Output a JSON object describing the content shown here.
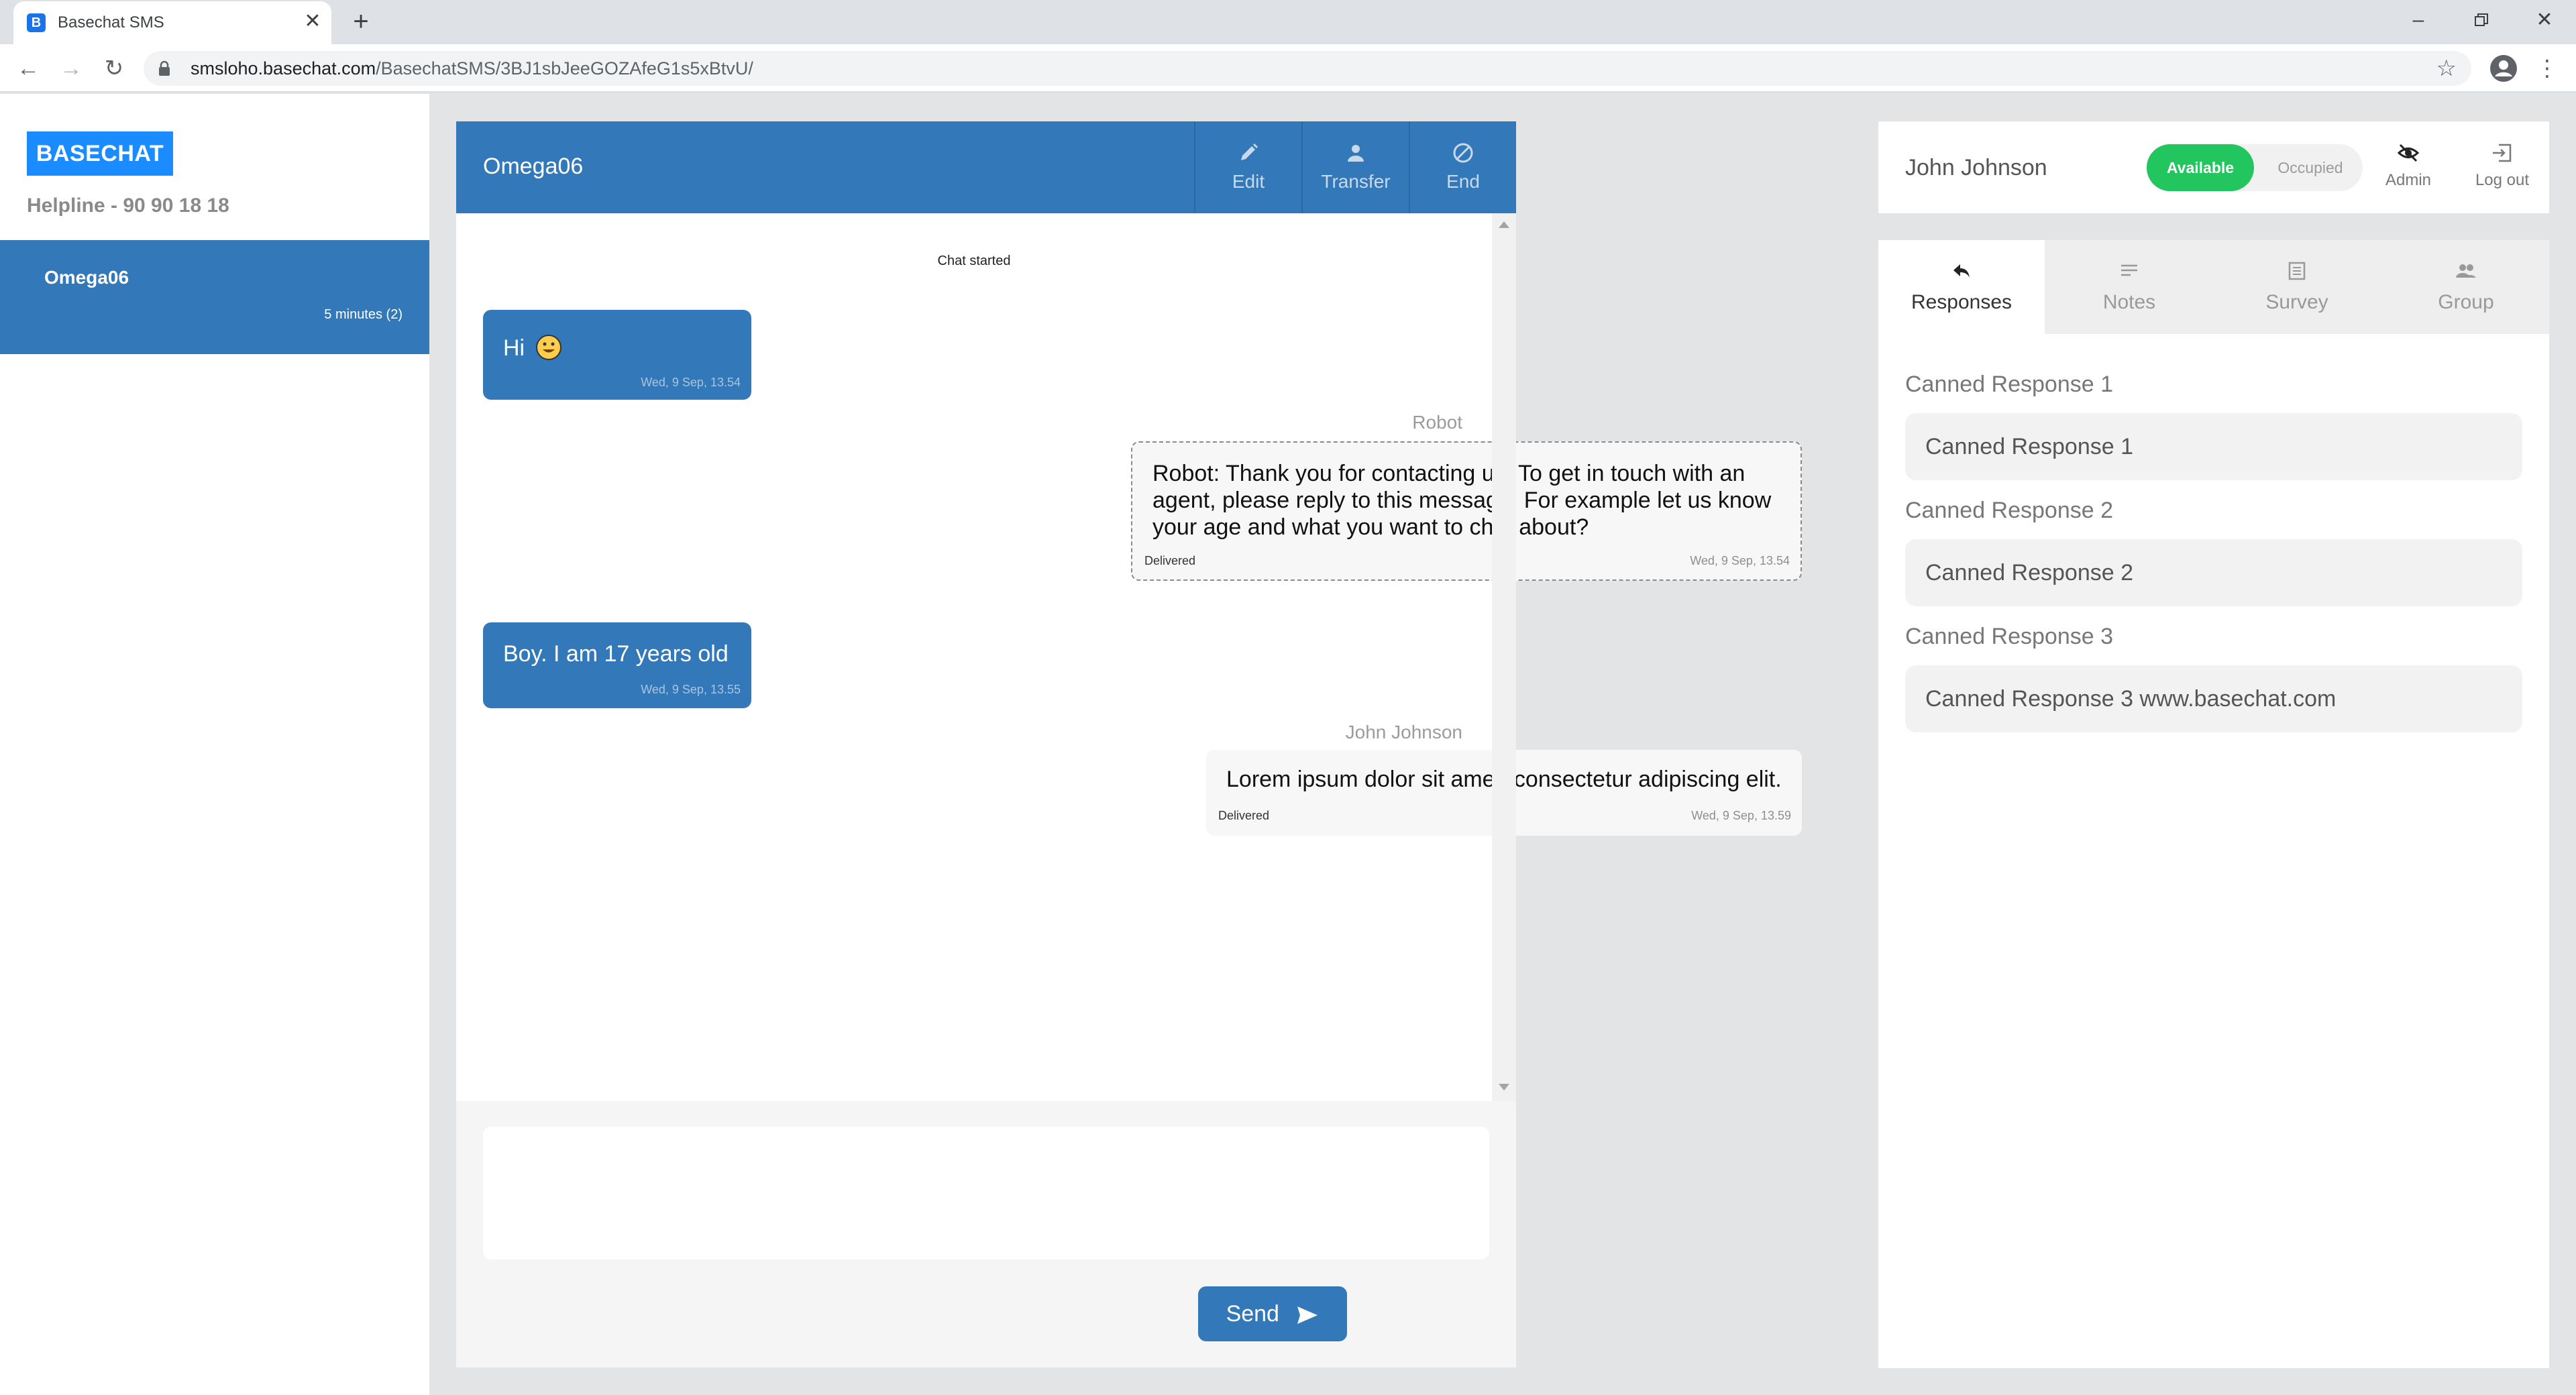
{
  "browser": {
    "tab_title": "Basechat SMS",
    "favicon_letter": "B",
    "url_host": "smsloho.basechat.com",
    "url_path": "/BasechatSMS/3BJ1sbJeeGOZAfeG1s5xBtvU/"
  },
  "sidebar": {
    "logo": "BASECHAT",
    "helpline": "Helpline - 90 90 18 18",
    "conversations": [
      {
        "name": "Omega06",
        "meta": "5 minutes (2)"
      }
    ]
  },
  "chat": {
    "title": "Omega06",
    "actions": {
      "edit": "Edit",
      "transfer": "Transfer",
      "end": "End"
    },
    "chat_started": "Chat started",
    "messages": [
      {
        "text": "Hi",
        "time": "Wed, 9 Sep, 13.54"
      },
      {
        "sender": "Robot",
        "text": "Robot: Thank you for contacting us. To get in touch with an agent, please reply to this message. For example let us know your age and what you want to chat about?",
        "status": "Delivered",
        "time": "Wed, 9 Sep, 13.54"
      },
      {
        "text": "Boy. I am 17 years old",
        "time": "Wed, 9 Sep, 13.55"
      },
      {
        "sender": "John Johnson",
        "text": "Lorem ipsum dolor sit amet, consectetur adipiscing elit.",
        "status": "Delivered",
        "time": "Wed, 9 Sep, 13.59"
      }
    ],
    "input_value": "",
    "send_label": "Send"
  },
  "agent": {
    "name": "John Johnson",
    "status_available": "Available",
    "status_occupied": "Occupied",
    "admin_label": "Admin",
    "logout_label": "Log out"
  },
  "side_panel": {
    "tabs": [
      "Responses",
      "Notes",
      "Survey",
      "Group"
    ],
    "active_tab": "Responses",
    "canned": [
      {
        "title": "Canned Response 1",
        "text": "Canned Response 1"
      },
      {
        "title": "Canned Response 2",
        "text": "Canned Response 2"
      },
      {
        "title": "Canned Response 3",
        "text": "Canned Response 3 www.basechat.com"
      }
    ]
  },
  "colors": {
    "brand_blue": "#3379b9",
    "logo_blue": "#1a8cff",
    "available_green": "#22c55e",
    "emoji_yellow": "#ffcc4d"
  }
}
